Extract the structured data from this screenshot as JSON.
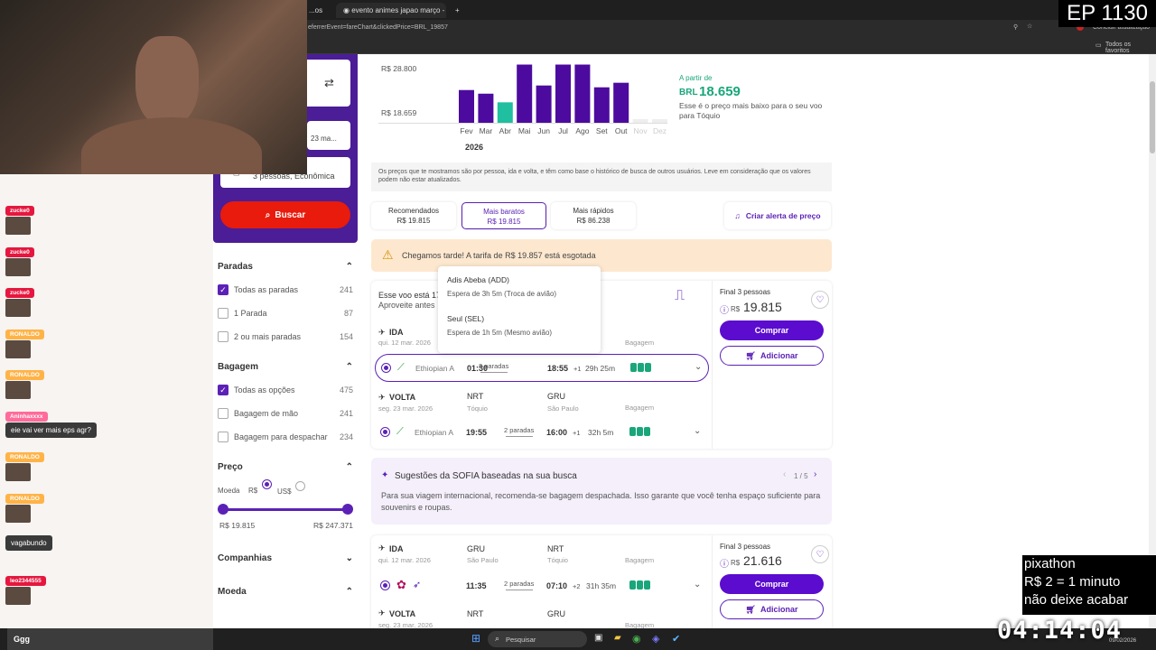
{
  "browser": {
    "tab_partial": "...os",
    "tab_active": "evento animes japao março - F",
    "new_tab": "+",
    "url_fragment": "eferrerEvent=fareChart&clickedPrice=BRL_19857",
    "update_label": "Concluir atualização",
    "bookmarks_all": "Todos os favoritos"
  },
  "overlays": {
    "episode": "EP 1130",
    "pixathon_line1": "pixathon",
    "pixathon_line2": "R$ 2 = 1 minuto",
    "pixathon_line3": "não deixe acabar",
    "timer": "04:14:04"
  },
  "chat": {
    "messages": [
      {
        "name": "zucke0",
        "text": "",
        "color": "#e5173f"
      },
      {
        "name": "zucke0",
        "text": "",
        "color": "#e5173f"
      },
      {
        "name": "zucke0",
        "text": "",
        "color": "#e5173f"
      },
      {
        "name": "RONALDO",
        "text": "",
        "color": "#ffb347"
      },
      {
        "name": "RONALDO",
        "text": "",
        "color": "#ffb347"
      },
      {
        "name": "Aninhaxxxx",
        "text": "eie vai ver mais eps agr?",
        "color": "#ff6b9a"
      },
      {
        "name": "RONALDO",
        "text": "",
        "color": "#ffb347"
      },
      {
        "name": "RONALDO",
        "text": "",
        "color": "#ffb347"
      },
      {
        "name": "",
        "text": "vagabundo",
        "color": "#ff9cb7"
      },
      {
        "name": "leo2344555",
        "text": "",
        "color": "#e5173f"
      }
    ],
    "input": "Ggg"
  },
  "search": {
    "swap_icon": "swap-icon",
    "date_partial": "23 ma...",
    "passengers": "3 pessoas, Econômica",
    "button": "Buscar"
  },
  "filters": {
    "paradas_title": "Paradas",
    "paradas": [
      {
        "label": "Todas as paradas",
        "count": "241",
        "checked": true
      },
      {
        "label": "1 Parada",
        "count": "87",
        "checked": false
      },
      {
        "label": "2 ou mais paradas",
        "count": "154",
        "checked": false
      }
    ],
    "bagagem_title": "Bagagem",
    "bagagem": [
      {
        "label": "Todas as opções",
        "count": "475",
        "checked": true
      },
      {
        "label": "Bagagem de mão",
        "count": "241",
        "checked": false
      },
      {
        "label": "Bagagem para despachar",
        "count": "234",
        "checked": false
      }
    ],
    "preco_title": "Preço",
    "moeda_label": "Moeda",
    "moeda_brl": "R$",
    "moeda_usd": "US$",
    "price_min": "R$ 19.815",
    "price_max": "R$ 247.371",
    "companhias_title": "Companhias",
    "moeda_title": "Moeda"
  },
  "fare_chart": {
    "y_top": "R$ 28.800",
    "y_low": "R$ 18.659",
    "year": "2026",
    "from_label": "A partir de",
    "from_currency": "BRL",
    "from_price": "18.659",
    "from_desc": "Esse é o preço mais baixo para o seu voo para Tóquio",
    "disclaimer": "Os preços que te mostramos são por pessoa, ida e volta, e têm como base o histórico de busca de outros usuários. Leve em consideração que os valores podem não estar atualizados."
  },
  "chart_data": {
    "type": "bar",
    "categories": [
      "Fev",
      "Mar",
      "Abr",
      "Mai",
      "Jun",
      "Jul",
      "Ago",
      "Set",
      "Out",
      "Nov",
      "Dez"
    ],
    "values": [
      23200,
      22400,
      20500,
      28800,
      24200,
      28800,
      28800,
      23800,
      24800,
      0,
      0
    ],
    "highlight_color": "#1fbfa0",
    "bar_color": "#4c0b9e",
    "highlight_index": 2,
    "title": "",
    "xlabel": "2026",
    "ylabel": "",
    "ylim": [
      16000,
      29500
    ],
    "gridlines": [
      "R$ 28.800",
      "R$ 18.659"
    ]
  },
  "sort_tabs": [
    {
      "label": "Recomendados",
      "price": "R$ 19.815",
      "active": false
    },
    {
      "label": "Mais baratos",
      "price": "R$ 19.815",
      "active": true
    },
    {
      "label": "Mais rápidos",
      "price": "R$ 86.238",
      "active": false
    }
  ],
  "price_alert": "Criar alerta de preço",
  "warning": "Chegamos tarde! A tarifa de R$ 19.857 está esgotada",
  "flight1": {
    "promo_line1": "Esse voo está 17",
    "promo_line2": "Aproveite antes",
    "tooltip": {
      "stop1_title": "Adis Abeba (ADD)",
      "stop1_desc": "Espera de 3h 5m (Troca de avião)",
      "stop2_title": "Seul (SEL)",
      "stop2_desc": "Espera de 1h 5m (Mesmo avião)"
    },
    "ida_label": "IDA",
    "ida_date": "qui. 12 mar. 2026",
    "bagagem_label": "Bagagem",
    "ida_airline": "Ethiopian A",
    "ida_dep": "01:30",
    "ida_stops": "2 paradas",
    "ida_arr": "18:55",
    "ida_plus": "+1",
    "ida_dur": "29h 25m",
    "volta_label": "VOLTA",
    "volta_date": "seg. 23 mar. 2026",
    "volta_from_code": "NRT",
    "volta_from_city": "Tóquio",
    "volta_to_code": "GRU",
    "volta_to_city": "São Paulo",
    "volta_airline": "Ethiopian A",
    "volta_dep": "19:55",
    "volta_stops": "2 paradas",
    "volta_arr": "16:00",
    "volta_plus": "+1",
    "volta_dur": "32h 5m",
    "final_label": "Final 3 pessoas",
    "currency": "R$",
    "price": "19.815",
    "buy": "Comprar",
    "add": "Adicionar"
  },
  "sofia": {
    "title": "Sugestões da SOFIA baseadas na sua busca",
    "pager": "1 / 5",
    "text": "Para sua viagem internacional, recomenda-se bagagem despachada. Isso garante que você tenha espaço suficiente para souvenirs e roupas."
  },
  "flight2": {
    "ida_label": "IDA",
    "ida_date": "qui. 12 mar. 2026",
    "from_code": "GRU",
    "from_city": "São Paulo",
    "to_code": "NRT",
    "to_city": "Tóquio",
    "bagagem_label": "Bagagem",
    "ida_dep": "11:35",
    "ida_stops": "2 paradas",
    "ida_arr": "07:10",
    "ida_plus": "+2",
    "ida_dur": "31h 35m",
    "volta_label": "VOLTA",
    "volta_date": "seg. 23 mar. 2026",
    "volta_from_code": "NRT",
    "volta_to_code": "GRU",
    "final_label": "Final 3 pessoas",
    "currency": "R$",
    "price": "21.616",
    "buy": "Comprar",
    "add": "Adicionar"
  },
  "taskbar": {
    "search": "Pesquisar",
    "date": "09/02/2026"
  }
}
